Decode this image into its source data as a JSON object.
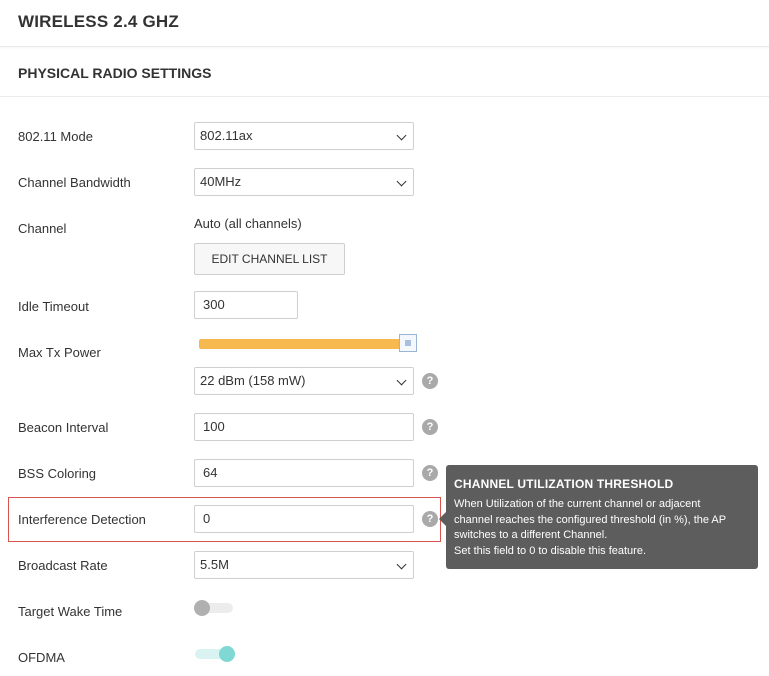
{
  "header": {
    "title": "WIRELESS 2.4 GHZ"
  },
  "section": {
    "title": "PHYSICAL RADIO SETTINGS"
  },
  "fields": {
    "mode": {
      "label": "802.11 Mode",
      "value": "802.11ax"
    },
    "bandwidth": {
      "label": "Channel Bandwidth",
      "value": "40MHz"
    },
    "channel": {
      "label": "Channel",
      "value": "Auto (all channels)",
      "button": "EDIT CHANNEL LIST"
    },
    "idle_timeout": {
      "label": "Idle Timeout",
      "value": "300"
    },
    "max_tx_power": {
      "label": "Max Tx Power",
      "value": "22 dBm (158 mW)",
      "slider_level": 1.0
    },
    "beacon_interval": {
      "label": "Beacon Interval",
      "value": "100"
    },
    "bss_coloring": {
      "label": "BSS Coloring",
      "value": "64"
    },
    "interference_detection": {
      "label": "Interference Detection",
      "value": "0"
    },
    "broadcast_rate": {
      "label": "Broadcast Rate",
      "value": "5.5M"
    },
    "target_wake_time": {
      "label": "Target Wake Time",
      "enabled": false
    },
    "ofdma": {
      "label": "OFDMA",
      "enabled": true
    }
  },
  "help_icon": "?",
  "tooltip": {
    "title": "CHANNEL UTILIZATION THRESHOLD",
    "line1": "When Utilization of the current channel or adjacent",
    "line2": "channel reaches the configured threshold (in %), the AP",
    "line3": "switches to a different Channel.",
    "line4": "Set this field to 0 to disable this feature."
  },
  "colors": {
    "slider": "#f5b94f",
    "toggle_on": "#7fd8d4",
    "toggle_off": "#b0b0b0",
    "highlight": "#d9534f",
    "tooltip_bg": "#5d5d5d"
  }
}
